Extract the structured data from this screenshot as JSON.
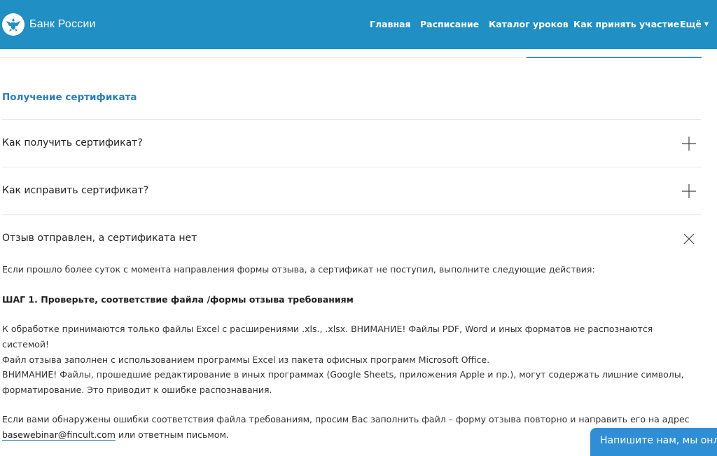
{
  "header": {
    "brand": "Банк России",
    "nav": [
      {
        "label": "Главная"
      },
      {
        "label": "Расписание"
      },
      {
        "label": "Каталог уроков"
      },
      {
        "label": "Как принять участие"
      },
      {
        "label": "Ещё"
      }
    ]
  },
  "section": {
    "title": "Получение сертификата"
  },
  "faq": [
    {
      "question": "Как получить сертификат?",
      "state": "collapsed",
      "icon": "plus-icon"
    },
    {
      "question": "Как исправить сертификат?",
      "state": "collapsed",
      "icon": "plus-icon"
    },
    {
      "question": "Отзыв отправлен, а сертификата нет",
      "state": "expanded",
      "icon": "close-icon"
    }
  ],
  "answer": {
    "intro": "Если прошло более суток с момента направления формы отзыва, а сертификат не поступил, выполните следующие действия:",
    "step1": "ШАГ 1. Проверьте, соответствие файла /формы отзыва требованиям",
    "p1_line1": "К обработке принимаются только файлы Excel с расширениями .xls., .xlsx. ВНИМАНИЕ! Файлы PDF, Word и иных форматов не распознаются системой!",
    "p1_line2": "Файл отзыва заполнен с использованием программы Excel из пакета офисных программ Microsoft Office.",
    "p2_line1": "ВНИМАНИЕ! Файлы, прошедшие редактирование в иных программах (Google Sheets, приложения Apple и пр.), могут содержать лишние символы,",
    "p2_line2": "форматирование. Это приводит к ошибке распознавания.",
    "p3_line1": "Если вами обнаружены ошибки соответствия файла требованиям, просим Вас заполнить файл – форму отзыва повторно и направить его на адрес",
    "p3_email": "basewebinar@fincult.com",
    "p3_after": " или ответным письмом."
  },
  "chat": {
    "label": "Напишите нам, мы онлайн!"
  },
  "colors": {
    "header_bg": "#1f8fc4",
    "accent": "#2a7fba",
    "chat_bg": "#2f8fd6"
  }
}
